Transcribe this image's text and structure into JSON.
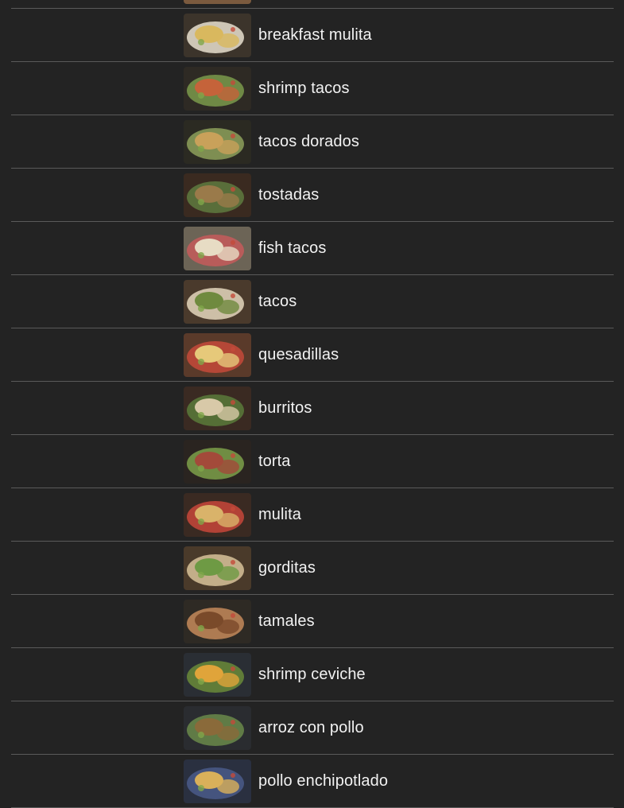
{
  "menu": {
    "items": [
      {
        "label": "",
        "icon": "food-photo",
        "tone": [
          "#7b5a3e",
          "#d9d2c4",
          "#c9b48e"
        ]
      },
      {
        "label": "breakfast mulita",
        "icon": "food-photo",
        "tone": [
          "#3c342b",
          "#d9b85e",
          "#e8e1cf"
        ]
      },
      {
        "label": "shrimp tacos",
        "icon": "food-photo",
        "tone": [
          "#2e2a24",
          "#c5633a",
          "#7a9a4b"
        ]
      },
      {
        "label": "tacos dorados",
        "icon": "food-photo",
        "tone": [
          "#2b2a22",
          "#c9a15a",
          "#8da05a"
        ]
      },
      {
        "label": "tostadas",
        "icon": "food-photo",
        "tone": [
          "#3a2a20",
          "#9a7a4a",
          "#5f7a3f"
        ]
      },
      {
        "label": "fish tacos",
        "icon": "food-photo",
        "tone": [
          "#6c6456",
          "#e7dcc4",
          "#c65b5b"
        ]
      },
      {
        "label": "tacos",
        "icon": "food-photo",
        "tone": [
          "#4a3a2c",
          "#6f8a3f",
          "#e4d7bd"
        ]
      },
      {
        "label": "quesadillas",
        "icon": "food-photo",
        "tone": [
          "#5a3a2a",
          "#e6c97a",
          "#c64a3a"
        ]
      },
      {
        "label": "burritos",
        "icon": "food-photo",
        "tone": [
          "#3a2a22",
          "#d8c9a8",
          "#5a7a3a"
        ]
      },
      {
        "label": "torta",
        "icon": "food-photo",
        "tone": [
          "#2a2420",
          "#a34a3a",
          "#7ca04a"
        ]
      },
      {
        "label": "mulita",
        "icon": "food-photo",
        "tone": [
          "#3a2a22",
          "#d9b36a",
          "#c8473a"
        ]
      },
      {
        "label": "gorditas",
        "icon": "food-photo",
        "tone": [
          "#4a3a2a",
          "#6e9a44",
          "#d8c39a"
        ]
      },
      {
        "label": "tamales",
        "icon": "food-photo",
        "tone": [
          "#2e2a24",
          "#7a4a2a",
          "#c48a5a"
        ]
      },
      {
        "label": "shrimp ceviche",
        "icon": "food-photo",
        "tone": [
          "#2a2e34",
          "#e0a43a",
          "#6a8a3a"
        ]
      },
      {
        "label": "arroz con pollo",
        "icon": "food-photo",
        "tone": [
          "#2a2c30",
          "#8a6a3a",
          "#6a8a4a"
        ]
      },
      {
        "label": "pollo enchipotlado",
        "icon": "food-photo",
        "tone": [
          "#2a3040",
          "#d9b05a",
          "#4a5a8a"
        ]
      }
    ]
  },
  "colors": {
    "background": "#232323",
    "divider": "#5a5a5a",
    "text": "#f2f2f2"
  }
}
